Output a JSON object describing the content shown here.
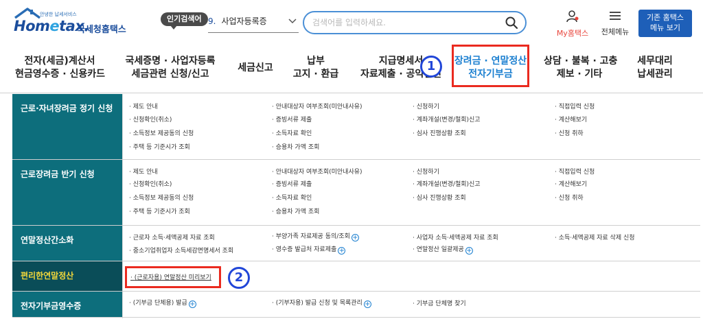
{
  "header": {
    "logo_tagline": "안녕한 납세서비스",
    "logo_text_home": "Hom",
    "logo_text_e": "e",
    "logo_text_tax": "tax.",
    "logo_korean": "국세청홈택스",
    "popular_label": "인기검색어",
    "popular_number": "9.",
    "popular_item": "사업자등록증",
    "search_placeholder": "검색어를 입력하세요.",
    "my_hometax": "My홈택스",
    "all_menu": "전체메뉴",
    "old_hometax_line1": "기존 홈택스",
    "old_hometax_line2": "메뉴 보기"
  },
  "nav": [
    {
      "line1": "전자(세금)계산서",
      "line2": "현금영수증 · 신용카드"
    },
    {
      "line1": "국세증명 · 사업자등록",
      "line2": "세금관련 신청/신고"
    },
    {
      "line1": "세금신고",
      "line2": ""
    },
    {
      "line1": "납부",
      "line2": "고지 · 환급"
    },
    {
      "line1": "지급명세서",
      "line2": "자료제출 · 공익법인"
    },
    {
      "line1": "장려금 · 연말정산",
      "line2": "전자기부금"
    },
    {
      "line1": "상담 · 불복 · 고충",
      "line2": "제보 · 기타"
    },
    {
      "line1": "세무대리",
      "line2": "납세관리"
    }
  ],
  "annotations": {
    "step1": "1",
    "step2": "2"
  },
  "menu": [
    {
      "title": "근로·자녀장려금 정기 신청",
      "links": [
        "제도 안내",
        "안내대상자 여부조회(미안내사유)",
        "신청하기",
        "직접입력 신청",
        "신청확인(취소)",
        "증빙서류 제출",
        "계좌개설(변경/철회)신고",
        "계산해보기",
        "소득정보 제공동의 신청",
        "소득자료 확인",
        "심사 진행상황 조회",
        "신청 취하",
        "주택 등 기준시가 조회",
        "승용차 가액 조회"
      ]
    },
    {
      "title": "근로장려금 반기 신청",
      "links": [
        "제도 안내",
        "안내대상자 여부조회(미안내사유)",
        "신청하기",
        "직접입력 신청",
        "신청확인(취소)",
        "증빙서류 제출",
        "계좌개설(변경/철회)신고",
        "계산해보기",
        "소득정보 제공동의 신청",
        "소득자료 확인",
        "심사 진행상황 조회",
        "신청 취하",
        "주택 등 기준시가 조회",
        "승용차 가액 조회"
      ]
    },
    {
      "title": "연말정산간소화",
      "links": [
        "근로자 소득·세액공제 자료 조회",
        "부양가족 자료제공 동의/조회",
        "사업자 소득·세액공제 자료 조회",
        "소득·세액공제 자료 삭제 신청",
        "중소기업취업자 소득세감면명세서 조회",
        "영수증 발급처 자료제출",
        "연말정산 일괄제공"
      ]
    },
    {
      "title": "편리한연말정산",
      "links": [
        "(근로자용) 연말정산 미리보기"
      ]
    },
    {
      "title": "전자기부금영수증",
      "links": [
        "(기부금 단체용) 발급",
        "(기부자용) 발급 신청 및 목록관리",
        "기부금 단체명 찾기"
      ]
    }
  ]
}
